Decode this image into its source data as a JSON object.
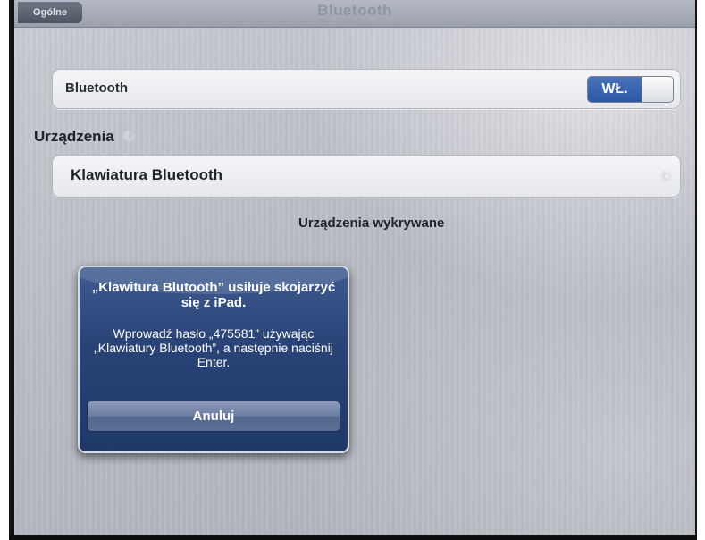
{
  "navbar": {
    "back_label": "Ogólne",
    "title": "Bluetooth"
  },
  "bluetooth_row": {
    "label": "Bluetooth",
    "toggle_on_label": "WŁ.",
    "toggle_state": "on"
  },
  "devices_section": {
    "header": "Urządzenia",
    "items": [
      {
        "label": "Klawiatura Bluetooth"
      }
    ],
    "discoverable_text": "Urządzenia wykrywane"
  },
  "alert": {
    "title": "„Klawitura Blutooth” usiłuje skojarzyć się z iPad.",
    "message": "Wprowadź hasło „475581” używając „Klawiatury Bluetooth”, a następnie naciśnij Enter.",
    "cancel_label": "Anuluj"
  },
  "colors": {
    "toggle_on": "#3a63b0",
    "alert_bg": "#2a4478"
  },
  "icons": {
    "activity": "activity-spinner-icon",
    "back": "back-chevron-icon"
  }
}
